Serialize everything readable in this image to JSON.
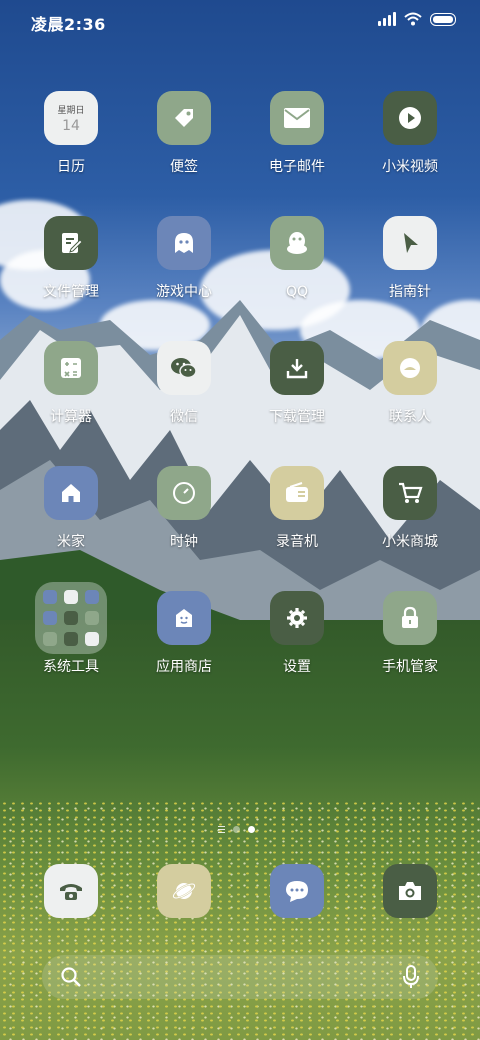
{
  "status_bar": {
    "time": "凌晨2:36",
    "icons": [
      "signal-icon",
      "wifi-icon",
      "battery-icon"
    ]
  },
  "apps": [
    {
      "label": "日历",
      "icon": "calendar-icon",
      "color": "#eef0f0",
      "calendar": {
        "weekday": "星期日",
        "day": "14"
      }
    },
    {
      "label": "便签",
      "icon": "tag-icon",
      "color": "#8fa78a"
    },
    {
      "label": "电子邮件",
      "icon": "mail-icon",
      "color": "#8fa78a"
    },
    {
      "label": "小米视频",
      "icon": "play-icon",
      "color": "#4a5e45"
    },
    {
      "label": "文件管理",
      "icon": "document-edit-icon",
      "color": "#4a5e45"
    },
    {
      "label": "游戏中心",
      "icon": "ghost-icon",
      "color": "#6c86b8"
    },
    {
      "label": "QQ",
      "icon": "qq-penguin-icon",
      "color": "#8fa78a"
    },
    {
      "label": "指南针",
      "icon": "compass-arrow-icon",
      "color": "#eef0f0"
    },
    {
      "label": "计算器",
      "icon": "calculator-icon",
      "color": "#8fa78a"
    },
    {
      "label": "微信",
      "icon": "wechat-icon",
      "color": "#eef0f0"
    },
    {
      "label": "下载管理",
      "icon": "download-icon",
      "color": "#4a5e45"
    },
    {
      "label": "联系人",
      "icon": "contact-face-icon",
      "color": "#d4cd9f"
    },
    {
      "label": "米家",
      "icon": "home-icon",
      "color": "#6c86b8"
    },
    {
      "label": "时钟",
      "icon": "clock-icon",
      "color": "#8fa78a"
    },
    {
      "label": "录音机",
      "icon": "radio-recorder-icon",
      "color": "#d4cd9f"
    },
    {
      "label": "小米商城",
      "icon": "cart-icon",
      "color": "#4a5e45"
    },
    {
      "label": "系统工具",
      "icon": "folder-icon",
      "color": "#ebf0f0"
    },
    {
      "label": "应用商店",
      "icon": "app-store-icon",
      "color": "#6c86b8"
    },
    {
      "label": "设置",
      "icon": "gear-icon",
      "color": "#4a5e45"
    },
    {
      "label": "手机管家",
      "icon": "lock-icon",
      "color": "#8fa78a"
    }
  ],
  "dock": [
    {
      "icon": "phone-icon",
      "color": "#eef0f0"
    },
    {
      "icon": "browser-planet-icon",
      "color": "#d4cd9f"
    },
    {
      "icon": "message-bubble-icon",
      "color": "#6c86b8"
    },
    {
      "icon": "camera-icon",
      "color": "#4a5e45"
    }
  ],
  "page_indicator": {
    "pages": 2,
    "current": 2
  },
  "search": {
    "icons": [
      "search-icon",
      "microphone-icon"
    ]
  }
}
